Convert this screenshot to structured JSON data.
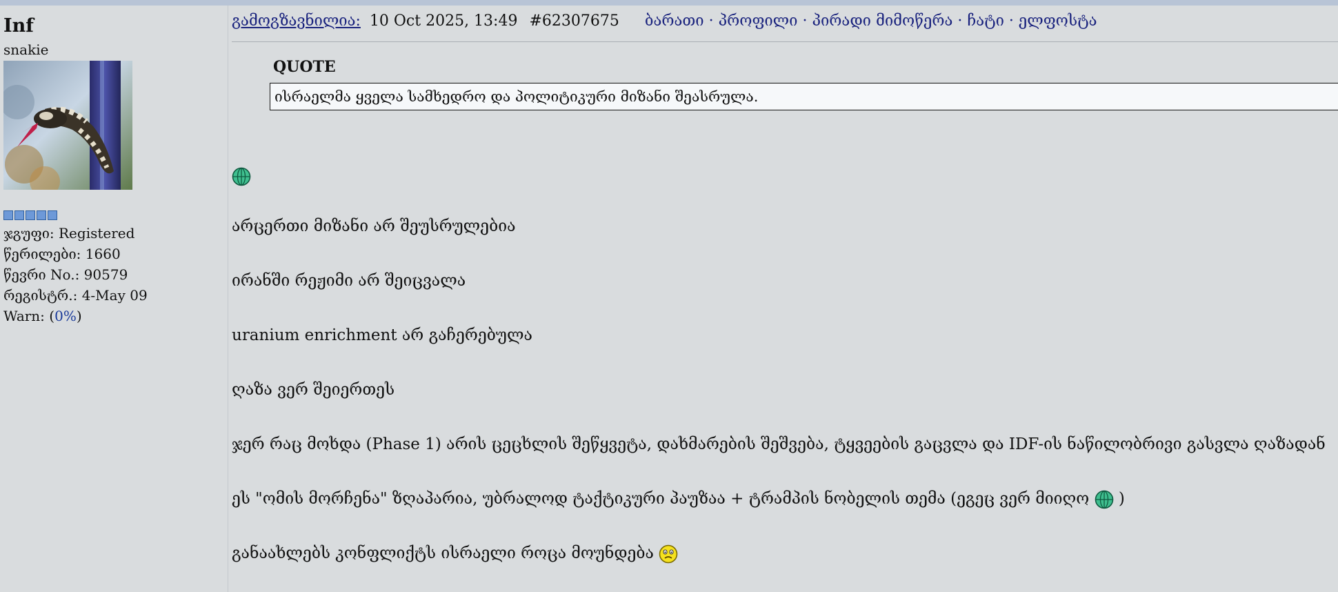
{
  "user": {
    "name": "Inf",
    "title": "snakie",
    "rank_pips": 5,
    "stats": [
      {
        "label": "ჯგუფი: ",
        "value": "Registered"
      },
      {
        "label": "წერილები: ",
        "value": "1660"
      },
      {
        "label": "წევრი No.: ",
        "value": "90579"
      },
      {
        "label": "რეგისტრ.: ",
        "value": "4-May 09"
      }
    ],
    "warn_label": "Warn: (",
    "warn_value": "0%",
    "warn_close": ")"
  },
  "post": {
    "posted_label": "გამოგზავნილია:",
    "date": "10 Oct 2025, 13:49",
    "post_id": "#62307675",
    "nav": [
      "ბარათი",
      "პროფილი",
      "პირადი მიმოწერა",
      "ჩატი",
      "ელფოსტა"
    ],
    "nav_separator": "·",
    "quote_label": "QUOTE",
    "quote_text": "ისრაელმა ყველა სამხედრო და პოლიტიკური მიზანი შეასრულა.",
    "lines": [
      "არცერთი მიზანი არ შეუსრულებია",
      "ირანში რეჟიმი არ შეიცვალა",
      "uranium enrichment არ გაჩერებულა",
      "ღაზა ვერ შეიერთეს",
      "ჯერ რაც მოხდა (Phase 1) არის ცეცხლის შეწყვეტა, დახმარების შეშვება, ტყვეების გაცვლა და IDF-ის ნაწილობრივი გასვლა ღაზადან",
      "ეს \"ომის მორჩენა\" ზღაპარია, უბრალოდ ტაქტიკური პაუზაა + ტრამპის ნობელის თემა (ეგეც ვერ მიიღო",
      ")",
      "განაახლებს კონფლიქტს ისრაელი როცა მოუნდება"
    ]
  },
  "colors": {
    "link": "#1a237e",
    "page_bg": "#d9dcde",
    "quote_bg": "#f6f8fa"
  }
}
